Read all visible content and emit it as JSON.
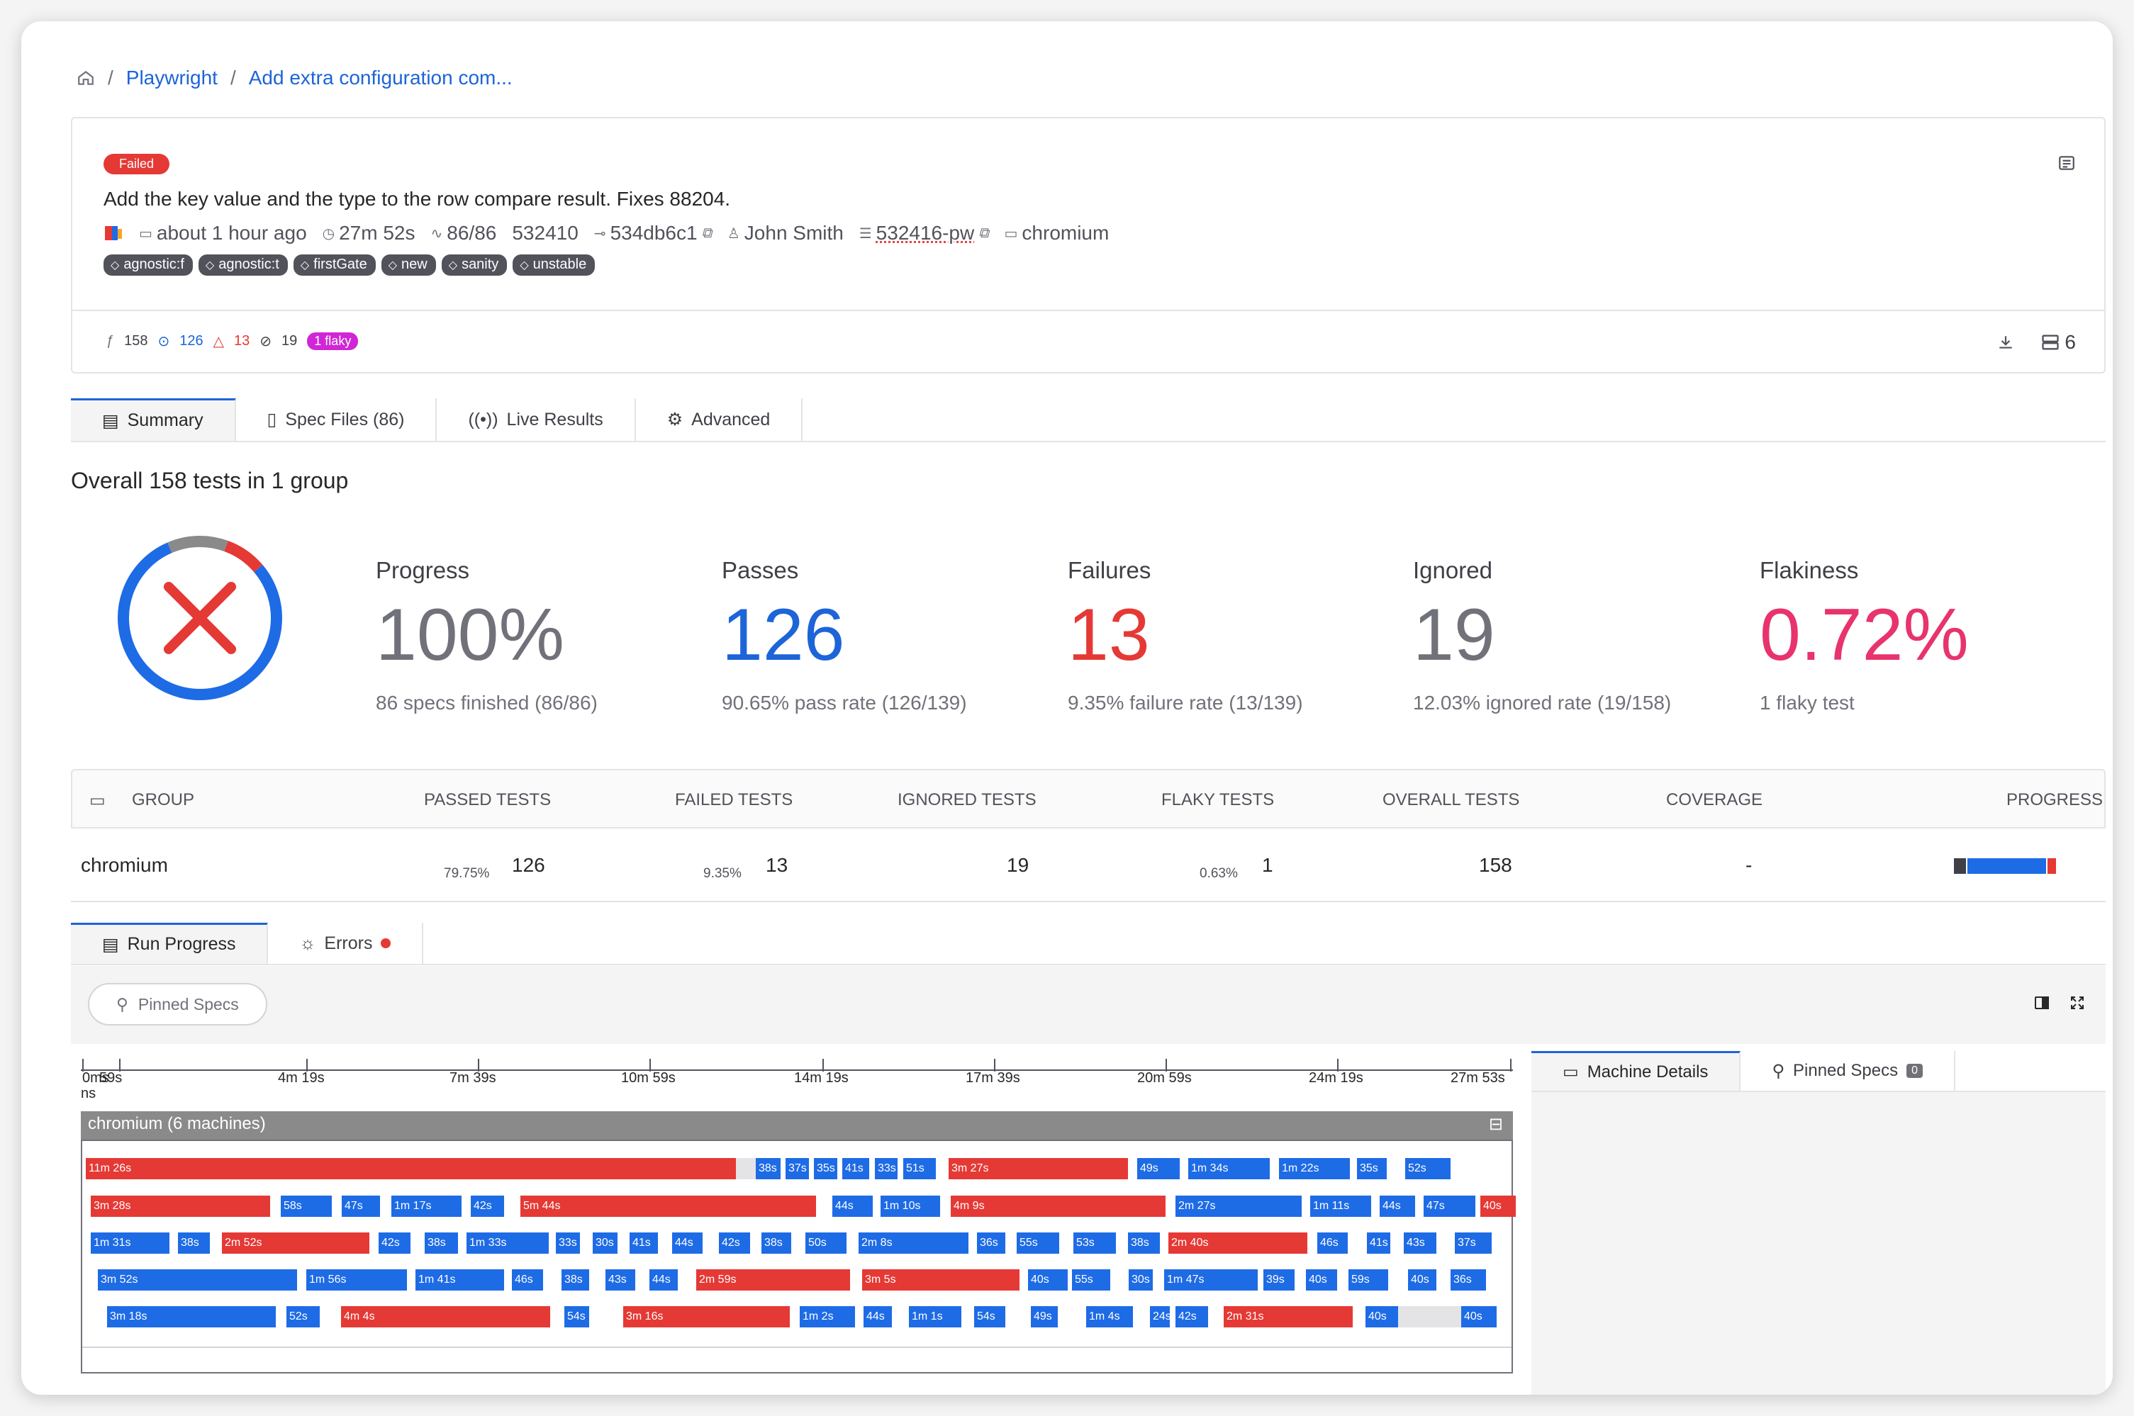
{
  "breadcrumb": {
    "project": "Playwright",
    "run": "Add extra configuration com..."
  },
  "run": {
    "status": "Failed",
    "commit_message": "Add the key value and the type to the row compare result. Fixes 88204.",
    "time": "about 1 hour ago",
    "duration": "27m 52s",
    "specs": "86/86",
    "build": "532410",
    "sha": "534db6c1",
    "author": "John Smith",
    "ci_build": "532416-pw",
    "browser": "chromium",
    "tags": [
      "agnostic:f",
      "agnostic:t",
      "firstGate",
      "new",
      "sanity",
      "unstable"
    ],
    "stats": {
      "total": "158",
      "passed": "126",
      "failed": "13",
      "skipped": "19",
      "flaky": "1 flaky"
    },
    "machines": "6"
  },
  "tabs": [
    "Summary",
    "Spec Files (86)",
    "Live Results",
    "Advanced"
  ],
  "overall": "Overall 158 tests in 1 group",
  "kpis": [
    {
      "label": "Progress",
      "value": "100%",
      "sub": "86 specs finished (86/86)",
      "color": "#71717a"
    },
    {
      "label": "Passes",
      "value": "126",
      "sub": "90.65% pass rate (126/139)",
      "color": "#1d64d8"
    },
    {
      "label": "Failures",
      "value": "13",
      "sub": "9.35% failure rate (13/139)",
      "color": "#e53935"
    },
    {
      "label": "Ignored",
      "value": "19",
      "sub": "12.03% ignored rate (19/158)",
      "color": "#71717a"
    },
    {
      "label": "Flakiness",
      "value": "0.72%",
      "sub": "1 flaky test",
      "color": "#e8336d"
    }
  ],
  "donut": {
    "passed": 126,
    "failed": 13,
    "ignored": 19
  },
  "group_table": {
    "headers": [
      "GROUP",
      "PASSED TESTS",
      "FAILED TESTS",
      "IGNORED TESTS",
      "FLAKY TESTS",
      "OVERALL TESTS",
      "COVERAGE",
      "PROGRESS"
    ],
    "row": {
      "group": "chromium",
      "passed_pct": "79.75%",
      "passed": "126",
      "failed_pct": "9.35%",
      "failed": "13",
      "ignored": "19",
      "flaky_pct": "0.63%",
      "flaky": "1",
      "overall": "158",
      "coverage": "-"
    },
    "progress": {
      "ignored": 19,
      "passed": 126,
      "failed": 13
    }
  },
  "bottom_tabs": [
    "Run Progress",
    "Errors"
  ],
  "pinned_specs": "Pinned Specs",
  "timeline": {
    "ticks": [
      "0ms",
      "59s",
      "4m 19s",
      "7m 39s",
      "10m 59s",
      "14m 19s",
      "17m 39s",
      "20m 59s",
      "24m 19s",
      "27m 53s"
    ],
    "tick_suffix": "ns",
    "group": "chromium (6 machines)",
    "rows": [
      [
        [
          "11m 26s",
          "f",
          85,
          1002
        ],
        [
          "",
          "g",
          1002,
          1030
        ],
        [
          "38s",
          "p",
          1030,
          1065
        ],
        [
          "37s",
          "p",
          1072,
          1105
        ],
        [
          "35s",
          "p",
          1112,
          1145
        ],
        [
          "41s",
          "p",
          1152,
          1190
        ],
        [
          "33s",
          "p",
          1198,
          1230
        ],
        [
          "51s",
          "p",
          1238,
          1284
        ],
        [
          "3m 27s",
          "f",
          1302,
          1555
        ],
        [
          "49s",
          "p",
          1568,
          1628
        ],
        [
          "1m 34s",
          "p",
          1640,
          1755
        ],
        [
          "1m 22s",
          "p",
          1768,
          1868
        ],
        [
          "35s",
          "p",
          1878,
          1920
        ],
        [
          "52s",
          "p",
          1946,
          2010
        ]
      ],
      [
        [
          "3m 28s",
          "f",
          92,
          345
        ],
        [
          "58s",
          "p",
          360,
          432
        ],
        [
          "47s",
          "p",
          446,
          500
        ],
        [
          "1m 17s",
          "p",
          516,
          615
        ],
        [
          "42s",
          "p",
          628,
          675
        ],
        [
          "5m 44s",
          "f",
          698,
          1115
        ],
        [
          "44s",
          "p",
          1138,
          1195
        ],
        [
          "1m 10s",
          "p",
          1206,
          1290
        ],
        [
          "4m 9s",
          "f",
          1305,
          1608
        ],
        [
          "2m 27s",
          "p",
          1622,
          1800
        ],
        [
          "1m 11s",
          "p",
          1812,
          1898
        ],
        [
          "44s",
          "p",
          1910,
          1960
        ],
        [
          "47s",
          "p",
          1972,
          2045
        ],
        [
          "40s",
          "f",
          2052,
          2102
        ]
      ],
      [
        [
          "1m 31s",
          "p",
          92,
          203
        ],
        [
          "38s",
          "p",
          215,
          260
        ],
        [
          "2m 52s",
          "f",
          277,
          485
        ],
        [
          "42s",
          "p",
          498,
          543
        ],
        [
          "38s",
          "p",
          563,
          610
        ],
        [
          "1m 33s",
          "p",
          622,
          738
        ],
        [
          "33s",
          "p",
          748,
          782
        ],
        [
          "30s",
          "p",
          800,
          835
        ],
        [
          "41s",
          "p",
          852,
          892
        ],
        [
          "44s",
          "p",
          912,
          955
        ],
        [
          "42s",
          "p",
          978,
          1022
        ],
        [
          "38s",
          "p",
          1038,
          1080
        ],
        [
          "50s",
          "p",
          1100,
          1158
        ],
        [
          "2m 8s",
          "p",
          1175,
          1330
        ],
        [
          "36s",
          "p",
          1342,
          1382
        ],
        [
          "55s",
          "p",
          1398,
          1458
        ],
        [
          "53s",
          "p",
          1478,
          1538
        ],
        [
          "38s",
          "p",
          1555,
          1600
        ],
        [
          "2m 40s",
          "f",
          1612,
          1808
        ],
        [
          "46s",
          "p",
          1822,
          1865
        ],
        [
          "41s",
          "p",
          1892,
          1925
        ],
        [
          "43s",
          "p",
          1944,
          1990
        ],
        [
          "37s",
          "p",
          2016,
          2068
        ]
      ],
      [
        [
          "3m 52s",
          "p",
          102,
          383
        ],
        [
          "1m 56s",
          "p",
          396,
          538
        ],
        [
          "1m 41s",
          "p",
          550,
          675
        ],
        [
          "46s",
          "p",
          686,
          730
        ],
        [
          "38s",
          "p",
          756,
          795
        ],
        [
          "43s",
          "p",
          818,
          860
        ],
        [
          "44s",
          "p",
          880,
          920
        ],
        [
          "2m 59s",
          "f",
          946,
          1163
        ],
        [
          "3m 5s",
          "f",
          1180,
          1402
        ],
        [
          "40s",
          "p",
          1414,
          1470
        ],
        [
          "55s",
          "p",
          1476,
          1530
        ],
        [
          "30s",
          "p",
          1556,
          1590
        ],
        [
          "1m 47s",
          "p",
          1606,
          1738
        ],
        [
          "39s",
          "p",
          1746,
          1790
        ],
        [
          "40s",
          "p",
          1806,
          1850
        ],
        [
          "59s",
          "p",
          1866,
          1922
        ],
        [
          "40s",
          "p",
          1950,
          1990
        ],
        [
          "36s",
          "p",
          2010,
          2060
        ]
      ],
      [
        [
          "3m 18s",
          "p",
          115,
          353
        ],
        [
          "52s",
          "p",
          368,
          415
        ],
        [
          "4m 4s",
          "f",
          445,
          740
        ],
        [
          "54s",
          "p",
          760,
          795
        ],
        [
          "3m 16s",
          "f",
          843,
          1078
        ],
        [
          "1m 2s",
          "p",
          1092,
          1170
        ],
        [
          "44s",
          "p",
          1182,
          1222
        ],
        [
          "1m 1s",
          "p",
          1246,
          1320
        ],
        [
          "54s",
          "p",
          1338,
          1382
        ],
        [
          "49s",
          "p",
          1418,
          1456
        ],
        [
          "1m 4s",
          "p",
          1496,
          1562
        ],
        [
          "24s",
          "p",
          1586,
          1614
        ],
        [
          "42s",
          "p",
          1622,
          1668
        ],
        [
          "2m 31s",
          "f",
          1690,
          1872
        ],
        [
          "40s",
          "p",
          1890,
          1936
        ],
        [
          "",
          "g",
          1936,
          2025
        ],
        [
          "40s",
          "p",
          2025,
          2075
        ]
      ]
    ]
  },
  "side_tabs": {
    "machine": "Machine Details",
    "pinned": "Pinned Specs",
    "pinned_count": "0"
  },
  "colors": {
    "passed": "#1e6be6",
    "failed": "#e53935",
    "ignored": "#3f3f46",
    "accent": "#1d64d8",
    "flaky": "#d026d7"
  }
}
